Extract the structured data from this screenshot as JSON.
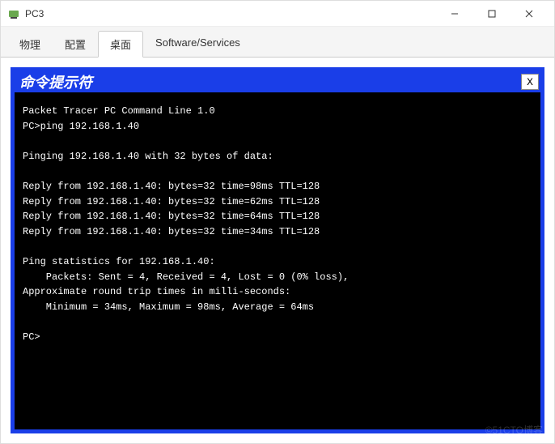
{
  "window": {
    "title": "PC3",
    "controls": {
      "min_label": "minimize",
      "max_label": "maximize",
      "close_label": "close"
    }
  },
  "tabs": {
    "items": [
      {
        "label": "物理"
      },
      {
        "label": "配置"
      },
      {
        "label": "桌面"
      },
      {
        "label": "Software/Services"
      }
    ],
    "active_index": 2
  },
  "cmd_window": {
    "title": "命令提示符",
    "close_label": "X"
  },
  "terminal": {
    "lines": [
      "Packet Tracer PC Command Line 1.0",
      "PC>ping 192.168.1.40",
      "",
      "Pinging 192.168.1.40 with 32 bytes of data:",
      "",
      "Reply from 192.168.1.40: bytes=32 time=98ms TTL=128",
      "Reply from 192.168.1.40: bytes=32 time=62ms TTL=128",
      "Reply from 192.168.1.40: bytes=32 time=64ms TTL=128",
      "Reply from 192.168.1.40: bytes=32 time=34ms TTL=128",
      "",
      "Ping statistics for 192.168.1.40:",
      "    Packets: Sent = 4, Received = 4, Lost = 0 (0% loss),",
      "Approximate round trip times in milli-seconds:",
      "    Minimum = 34ms, Maximum = 98ms, Average = 64ms",
      "",
      "PC>"
    ]
  },
  "watermark": "©51CTO博客"
}
